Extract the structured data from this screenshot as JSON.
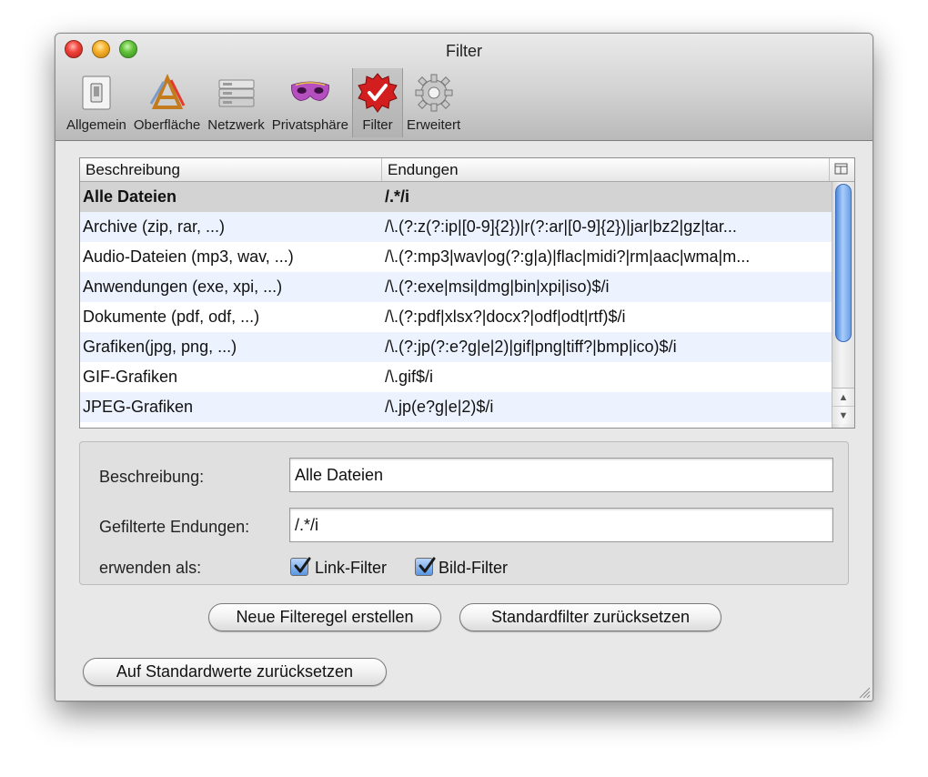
{
  "window": {
    "title": "Filter"
  },
  "toolbar": {
    "items": [
      {
        "label": "Allgemein",
        "icon": "switch-icon"
      },
      {
        "label": "Oberfläche",
        "icon": "appearance-icon"
      },
      {
        "label": "Netzwerk",
        "icon": "network-icon"
      },
      {
        "label": "Privatsphäre",
        "icon": "mask-icon"
      },
      {
        "label": "Filter",
        "icon": "filter-badge-icon",
        "selected": true
      },
      {
        "label": "Erweitert",
        "icon": "gear-icon"
      }
    ]
  },
  "table": {
    "columns": [
      "Beschreibung",
      "Endungen"
    ],
    "rows": [
      {
        "desc": "Alle Dateien",
        "ext": "/.*/i"
      },
      {
        "desc": "Archive (zip, rar, ...)",
        "ext": "/\\.(?:z(?:ip|[0-9]{2})|r(?:ar|[0-9]{2})|jar|bz2|gz|tar..."
      },
      {
        "desc": "Audio-Dateien (mp3, wav, ...)",
        "ext": "/\\.(?:mp3|wav|og(?:g|a)|flac|midi?|rm|aac|wma|m..."
      },
      {
        "desc": "Anwendungen (exe, xpi, ...)",
        "ext": "/\\.(?:exe|msi|dmg|bin|xpi|iso)$/i"
      },
      {
        "desc": "Dokumente (pdf, odf, ...)",
        "ext": "/\\.(?:pdf|xlsx?|docx?|odf|odt|rtf)$/i"
      },
      {
        "desc": "Grafiken(jpg, png, ...)",
        "ext": "/\\.(?:jp(?:e?g|e|2)|gif|png|tiff?|bmp|ico)$/i"
      },
      {
        "desc": "GIF-Grafiken",
        "ext": "/\\.gif$/i"
      },
      {
        "desc": "JPEG-Grafiken",
        "ext": "/\\.jp(e?g|e|2)$/i"
      }
    ]
  },
  "form": {
    "desc_label": "Beschreibung:",
    "desc_value": "Alle Dateien",
    "ext_label": "Gefilterte Endungen:",
    "ext_value": "/.*/i",
    "use_as_label": "erwenden als:",
    "link_filter_label": "Link-Filter",
    "image_filter_label": "Bild-Filter"
  },
  "buttons": {
    "new_rule": "Neue Filteregel erstellen",
    "reset_default_filters": "Standardfilter zurücksetzen",
    "reset_defaults": "Auf Standardwerte zurücksetzen"
  },
  "colors": {
    "selection": "#d3d3d3",
    "alt_row": "#edf3fe",
    "scroll_thumb": "#5a94e0",
    "filter_badge": "#d21e1e"
  }
}
